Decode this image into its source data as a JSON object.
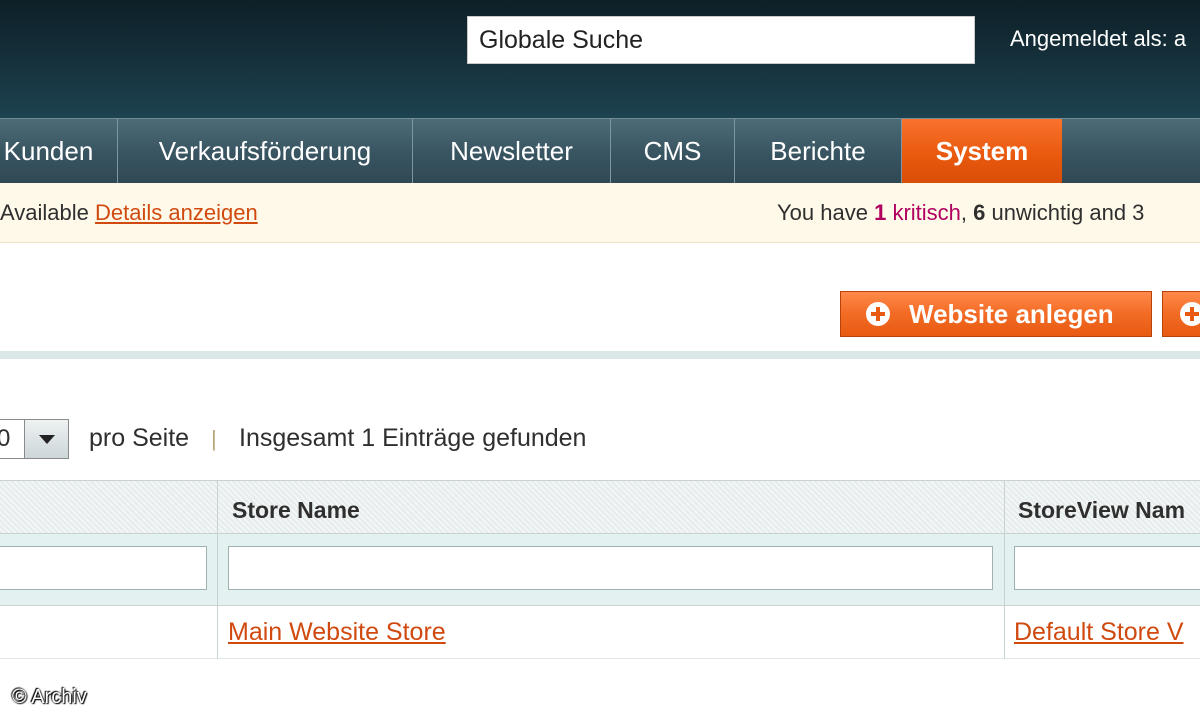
{
  "header": {
    "search_value": "Globale Suche",
    "logged_in": "Angemeldet als: a"
  },
  "nav": {
    "items": [
      {
        "label": "Kunden"
      },
      {
        "label": "Verkaufsförderung"
      },
      {
        "label": "Newsletter"
      },
      {
        "label": "CMS"
      },
      {
        "label": "Berichte"
      },
      {
        "label": "System",
        "active": true
      }
    ]
  },
  "notice": {
    "left_text": "Available",
    "left_link": "Details anzeigen",
    "right_prefix": "You have",
    "critical_count": "1",
    "critical_label": "kritisch",
    "comma": ",",
    "minor_count": "6",
    "minor_label": "unwichtig and 3"
  },
  "actions": {
    "add_website": "Website anlegen"
  },
  "pager": {
    "per_page_value": "0",
    "per_page_label": "pro Seite",
    "separator": "|",
    "total_text": "Insgesamt 1 Einträge gefunden"
  },
  "grid": {
    "columns": [
      "Store Name",
      "StoreView Nam"
    ],
    "rows": [
      {
        "store_name": "Main Website Store",
        "storeview_name": "Default Store V"
      }
    ]
  },
  "watermark": "© Archiv",
  "colors": {
    "header_dark": "#16323d",
    "nav_bg": "#3a5663",
    "accent_orange": "#ea5a0f",
    "link": "#d04a10",
    "notice_bg": "#fff9e9",
    "critical": "#b00060"
  }
}
